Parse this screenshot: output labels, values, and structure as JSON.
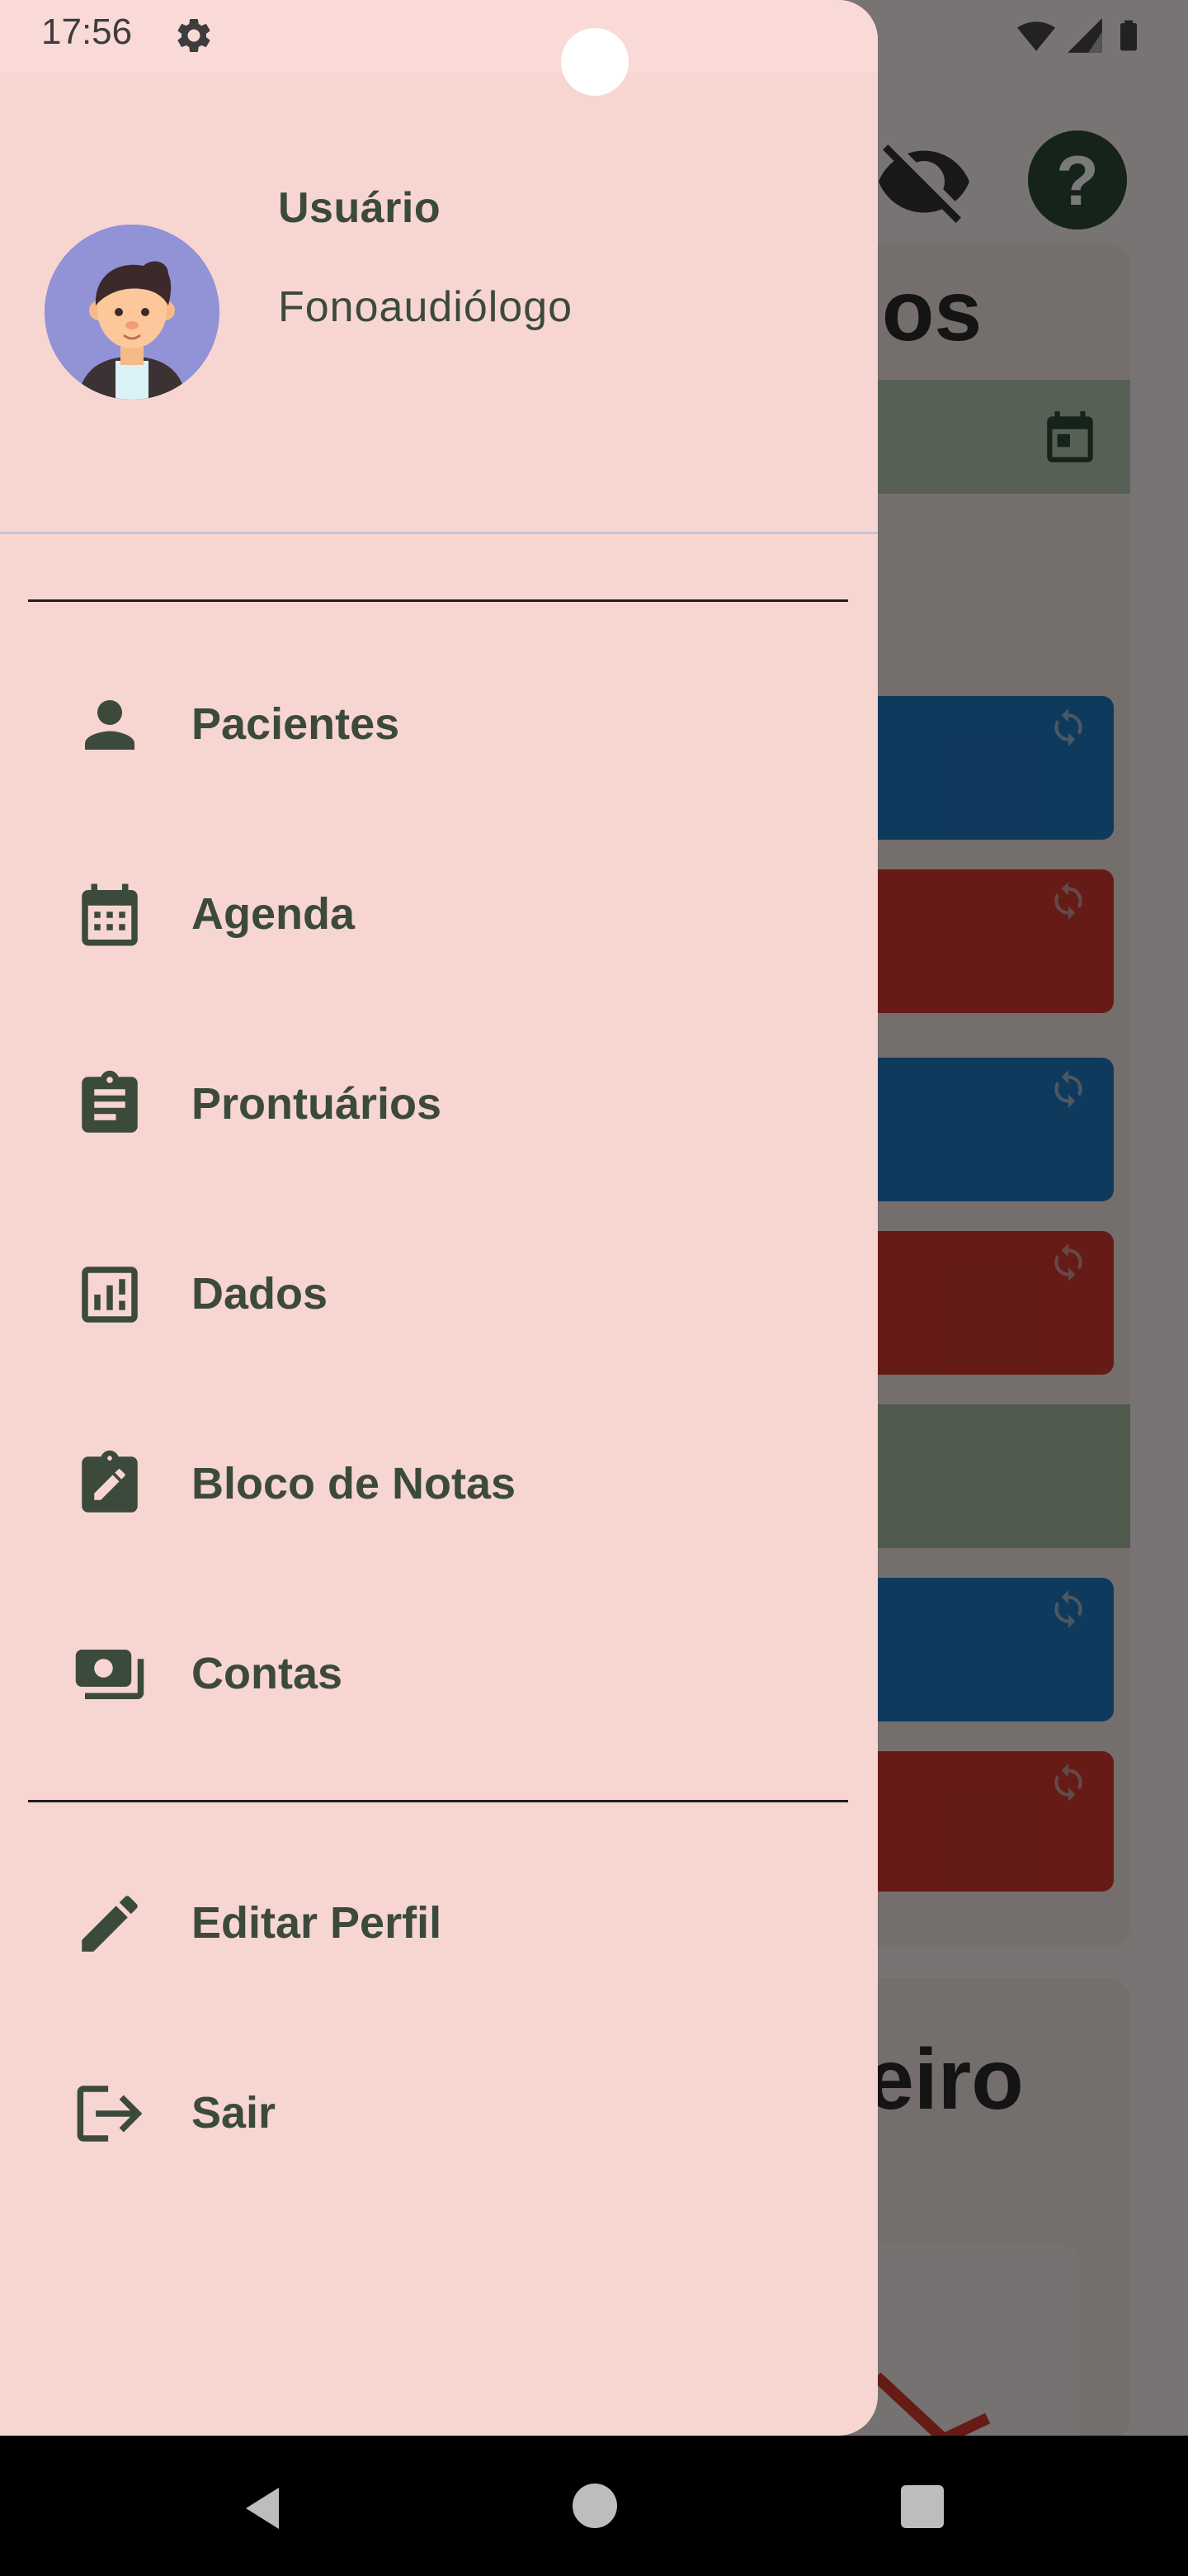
{
  "status_bar": {
    "time": "17:56",
    "icons": [
      "gear-icon",
      "wifi-icon",
      "signal-icon",
      "battery-icon"
    ]
  },
  "background_app": {
    "section_title_partial": "ios",
    "section2_title_partial": "eiro",
    "top_icons": [
      "visibility-off-icon",
      "help-icon"
    ],
    "tile_colors": {
      "blue": "#1f79c4",
      "red": "#d63a2e",
      "green": "#a7bca2"
    }
  },
  "drawer": {
    "user_name": "Usuário",
    "user_role": "Fonoaudiólogo",
    "menu_items": [
      {
        "label": "Pacientes",
        "icon": "person-icon"
      },
      {
        "label": "Agenda",
        "icon": "calendar-icon"
      },
      {
        "label": "Prontuários",
        "icon": "clipboard-icon"
      },
      {
        "label": "Dados",
        "icon": "chart-icon"
      },
      {
        "label": "Bloco de Notas",
        "icon": "note-edit-icon"
      },
      {
        "label": "Contas",
        "icon": "money-icon"
      }
    ],
    "footer_items": [
      {
        "label": "Editar Perfil",
        "icon": "edit-icon"
      },
      {
        "label": "Sair",
        "icon": "logout-icon"
      }
    ]
  },
  "colors": {
    "drawer_bg": "#f7d6d2",
    "text_primary": "#3c4a3c"
  },
  "navigation_bar": {
    "buttons": [
      "back-button",
      "home-button",
      "recents-button"
    ]
  }
}
